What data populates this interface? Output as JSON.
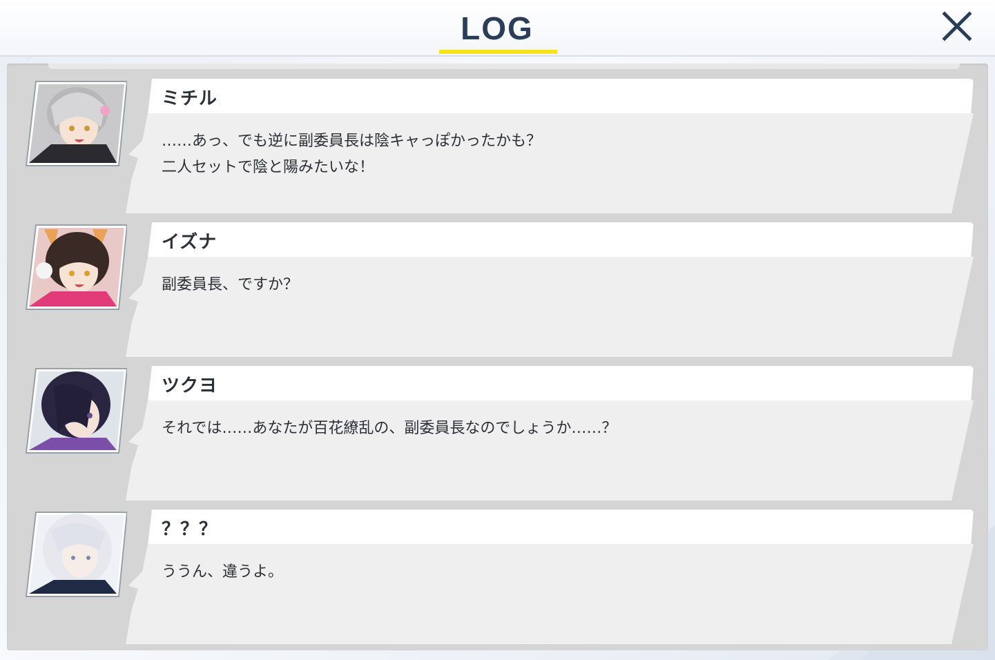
{
  "header": {
    "title": "LOG"
  },
  "log_entries": [
    {
      "speaker": "ミチル",
      "text": "……あっ、でも逆に副委員長は陰キャっぽかったかも？\n二人セットで陰と陽みたいな！",
      "avatar": "avatar-michiru"
    },
    {
      "speaker": "イズナ",
      "text": "副委員長、ですか？",
      "avatar": "avatar-izuna"
    },
    {
      "speaker": "ツクヨ",
      "text": "それでは……あなたが百花繚乱の、副委員長なのでしょうか……？",
      "avatar": "avatar-tsukuyo"
    },
    {
      "speaker": "？？？",
      "text": "ううん、違うよ。",
      "avatar": "avatar-unknown"
    }
  ],
  "colors": {
    "title": "#2b3d57",
    "accent_underline": "#f4e31d",
    "panel": "#d5d5d5",
    "name_bar": "#ffffff",
    "bubble": "#efefef"
  }
}
